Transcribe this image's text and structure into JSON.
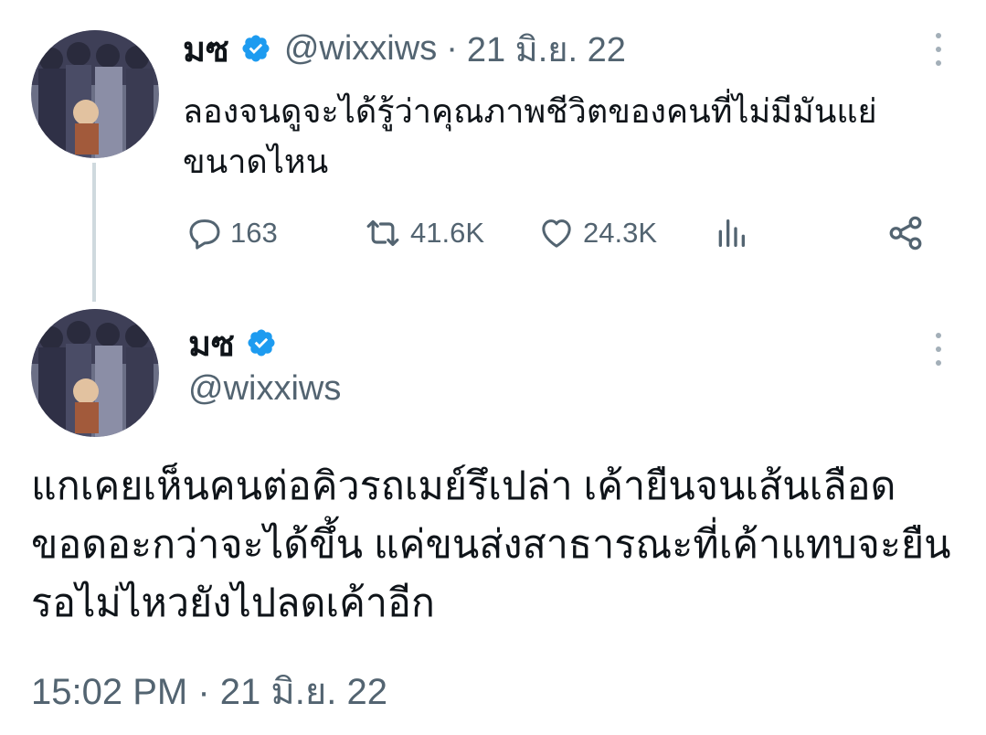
{
  "parent_tweet": {
    "display_name": "มซ",
    "handle": "@wixxiws",
    "separator": "·",
    "date": "21 มิ.ย. 22",
    "text": "ลองจนดูจะได้รู้ว่าคุณภาพชีวิตของคนที่ไม่มีมันแย่ขนาดไหน",
    "replies": "163",
    "retweets": "41.6K",
    "likes": "24.3K"
  },
  "main_tweet": {
    "display_name": "มซ",
    "handle": "@wixxiws",
    "text": "แกเคยเห็นคนต่อคิวรถเมย์รึเปล่า  เค้ายืนจนเส้นเลือดขอดอะกว่าจะได้ขึ้น แค่ขนส่งสาธารณะที่เค้าแทบจะยืนรอไม่ไหวยังไปลดเค้าอีก",
    "timestamp": "15:02 PM · 21 มิ.ย. 22"
  },
  "icons": {
    "verified": "verified-badge-icon",
    "reply": "reply-icon",
    "retweet": "retweet-icon",
    "like": "heart-icon",
    "views": "analytics-icon",
    "share": "share-icon",
    "more": "more-vertical-icon"
  },
  "colors": {
    "verified_blue": "#1d9bf0",
    "muted_text": "#536471",
    "primary_text": "#0f1419",
    "thread_line": "#cfd9de"
  }
}
